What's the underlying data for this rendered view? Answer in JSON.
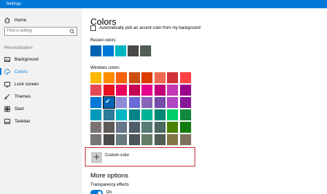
{
  "window": {
    "title": "Settings"
  },
  "sidebar": {
    "home_label": "Home",
    "search_placeholder": "Find a setting",
    "section_title": "Personalization",
    "items": [
      {
        "label": "Background",
        "icon": "picture-icon",
        "active": false
      },
      {
        "label": "Colors",
        "icon": "palette-icon",
        "active": true
      },
      {
        "label": "Lock screen",
        "icon": "lock-screen-icon",
        "active": false
      },
      {
        "label": "Themes",
        "icon": "brush-icon",
        "active": false
      },
      {
        "label": "Start",
        "icon": "start-icon",
        "active": false
      },
      {
        "label": "Taskbar",
        "icon": "taskbar-icon",
        "active": false
      }
    ]
  },
  "main": {
    "title": "Colors",
    "auto_accent_label": "Automatically pick an accent color from my background",
    "auto_accent_checked": false,
    "recent_colors_label": "Recent colors",
    "recent_colors": [
      "#0063b1",
      "#0078d7",
      "#00b7c3",
      "#4c4a48",
      "#525e54"
    ],
    "windows_colors_label": "Windows colors",
    "selected_color": "#0063b1",
    "windows_colors": [
      [
        "#ffb900",
        "#ff8c00",
        "#f7630c",
        "#ca5010",
        "#da3b01",
        "#ef6950",
        "#d13438",
        "#ff4343"
      ],
      [
        "#e74856",
        "#e81123",
        "#ea005e",
        "#c30052",
        "#e3008c",
        "#bf0077",
        "#c239b3",
        "#9a0089"
      ],
      [
        "#0078d7",
        "#0063b1",
        "#8e8cd8",
        "#6b69d6",
        "#8764b8",
        "#744da9",
        "#b146c2",
        "#881798"
      ],
      [
        "#0099bc",
        "#2d7d9a",
        "#00b7c3",
        "#038387",
        "#00b294",
        "#018574",
        "#00cc6a",
        "#10893e"
      ],
      [
        "#7a7574",
        "#5d5a58",
        "#68768a",
        "#515c6b",
        "#567c73",
        "#486860",
        "#498205",
        "#107c10"
      ],
      [
        "#767676",
        "#4c4a48",
        "#69797e",
        "#4a5459",
        "#647c64",
        "#525e54",
        "#847545",
        "#7e735f"
      ]
    ],
    "custom_color_label": "Custom color",
    "more_options_title": "More options",
    "transparency_label": "Transparency effects",
    "transparency_value": "On"
  },
  "colors": {
    "accent": "#0078d7",
    "highlight_box": "#c1272d"
  }
}
